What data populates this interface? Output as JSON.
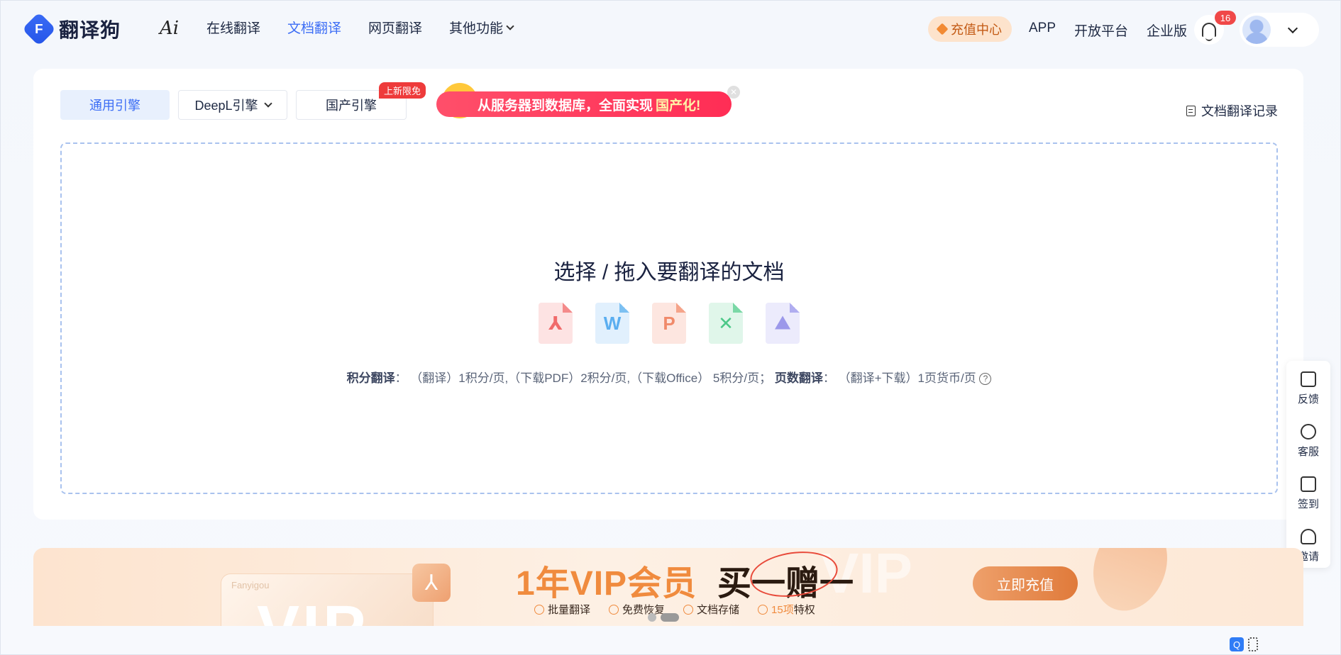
{
  "header": {
    "brand": "翻译狗",
    "logo_letter": "F",
    "ai_label": "Ai",
    "nav": [
      {
        "label": "在线翻译"
      },
      {
        "label": "文档翻译"
      },
      {
        "label": "网页翻译"
      },
      {
        "label": "其他功能"
      }
    ],
    "recharge_label": "充值中心",
    "links": [
      {
        "label": "APP"
      },
      {
        "label": "开放平台"
      },
      {
        "label": "企业版"
      }
    ],
    "notification_count": "16"
  },
  "engines": {
    "general": "通用引擎",
    "deepl": "DeepL引擎",
    "domestic": "国产引擎",
    "new_tag": "上新限免"
  },
  "promo": {
    "text": "从服务器到数据库，全面实现",
    "highlight": "国产化!",
    "close": "✕"
  },
  "record_label": "文档翻译记录",
  "dropzone": {
    "title": "选择 / 拖入要翻译的文档",
    "file_icons": [
      {
        "type": "pdf",
        "glyph": "⅄"
      },
      {
        "type": "word",
        "glyph": "W"
      },
      {
        "type": "ppt",
        "glyph": "P"
      },
      {
        "type": "excel",
        "glyph": "✕"
      },
      {
        "type": "image",
        "glyph": "⛰"
      }
    ],
    "pricing_points_label": "积分翻译",
    "pricing_points_text": "： （翻译）1积分/页,（下载PDF）2积分/页,（下载Office） 5积分/页；",
    "pricing_pages_label": "页数翻译",
    "pricing_pages_text": "： （翻译+下载）1页货币/页",
    "help": "?"
  },
  "float_bar": [
    {
      "label": "反馈",
      "icon": "feedback-icon"
    },
    {
      "label": "客服",
      "icon": "headset-icon"
    },
    {
      "label": "签到",
      "icon": "calendar-check-icon"
    },
    {
      "label": "邀请",
      "icon": "add-user-icon"
    }
  ],
  "banner": {
    "card_brand": "Fanyigou",
    "card_big": "VIP",
    "pdf_glyph": "⅄",
    "title": "1年VIP会员",
    "gift": "买一赠一",
    "watermark": "VIP",
    "benefits": [
      "批量翻译",
      "免费恢复",
      "文档存储"
    ],
    "benefit_count": "15项",
    "benefit_suffix": "特权",
    "buy_label": "立即充值"
  },
  "corner_icon_letter": "Q"
}
